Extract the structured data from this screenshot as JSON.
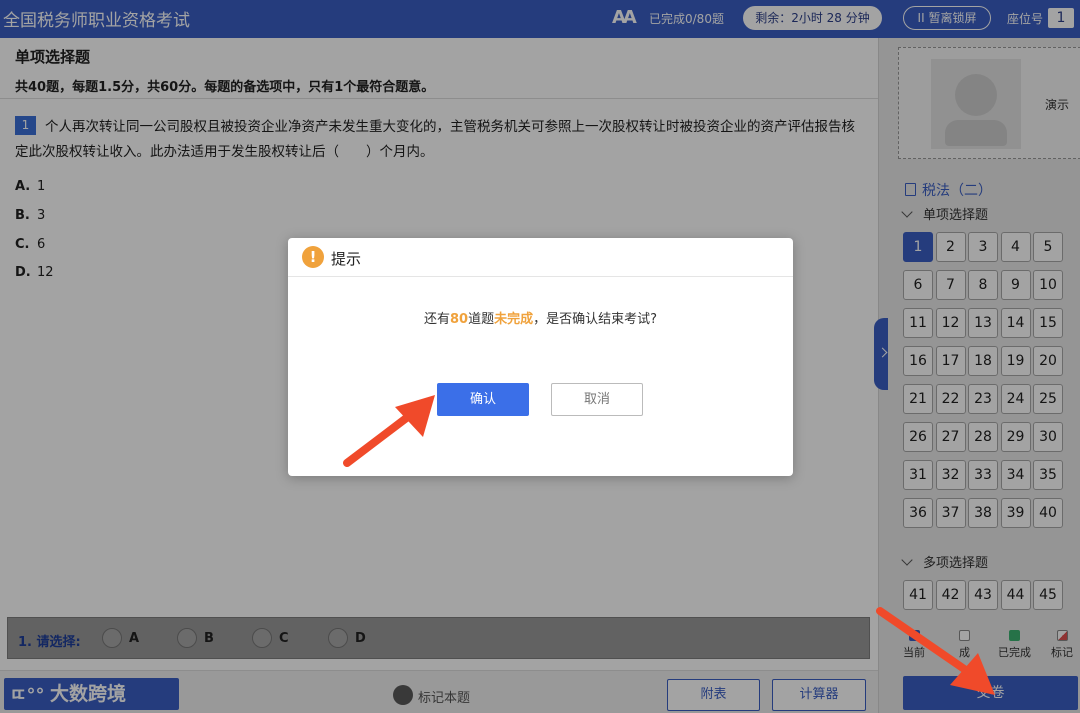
{
  "topbar": {
    "title": "全国税务师职业资格考试",
    "font_icon": "AA",
    "progress": "已完成0/80题",
    "timer": "剩余：2小时 28 分钟",
    "lock": "II 暂离锁屏",
    "seat_label": "座位号",
    "seat_number": "1"
  },
  "question": {
    "section_title": "单项选择题",
    "section_desc": "共40题，每题1.5分，共60分。每题的备选项中，只有1个最符合题意。",
    "number": "1",
    "text": "个人再次转让同一公司股权且被投资企业净资产未发生重大变化的，主管税务机关可参照上一次股权转让时被投资企业的资产评估报告核定此次股权转让收入。此办法适用于发生股权转让后（　　）个月内。",
    "options": [
      {
        "key": "A.",
        "value": "1"
      },
      {
        "key": "B.",
        "value": "3"
      },
      {
        "key": "C.",
        "value": "6"
      },
      {
        "key": "D.",
        "value": "12"
      }
    ]
  },
  "answer_bar": {
    "label": "1. 请选择:",
    "choices": [
      "A",
      "B",
      "C",
      "D"
    ]
  },
  "bottombar": {
    "logo_text": "大数跨境",
    "mark_label": "标记本题",
    "appendix_label": "附表",
    "calculator_label": "计算器"
  },
  "right_panel": {
    "camera_label": "演示",
    "subject": "税法（二）",
    "group1_title": "单项选择题",
    "group1_numbers": [
      "1",
      "2",
      "3",
      "4",
      "5",
      "6",
      "7",
      "8",
      "9",
      "10",
      "11",
      "12",
      "13",
      "14",
      "15",
      "16",
      "17",
      "18",
      "19",
      "20",
      "21",
      "22",
      "23",
      "24",
      "25",
      "26",
      "27",
      "28",
      "29",
      "30",
      "31",
      "32",
      "33",
      "34",
      "35",
      "36",
      "37",
      "38",
      "39",
      "40"
    ],
    "group2_title": "多项选择题",
    "group2_numbers": [
      "41",
      "42",
      "43",
      "44",
      "45"
    ],
    "legend": {
      "current": "当前",
      "unfinished": "成",
      "done": "已完成",
      "marked": "标记"
    },
    "submit_label": "交卷"
  },
  "modal": {
    "title": "提示",
    "message_prefix": "还有",
    "message_count": "80",
    "message_mid": "道题",
    "message_highlight": "未完成",
    "message_suffix": "，是否确认结束考试?",
    "confirm_label": "确认",
    "cancel_label": "取消"
  },
  "colors": {
    "primary": "#3b5fc4",
    "confirm": "#3b6fe8",
    "warning": "#f0a23c",
    "arrow": "#f04a2a",
    "done_swatch": "#3cb371"
  }
}
